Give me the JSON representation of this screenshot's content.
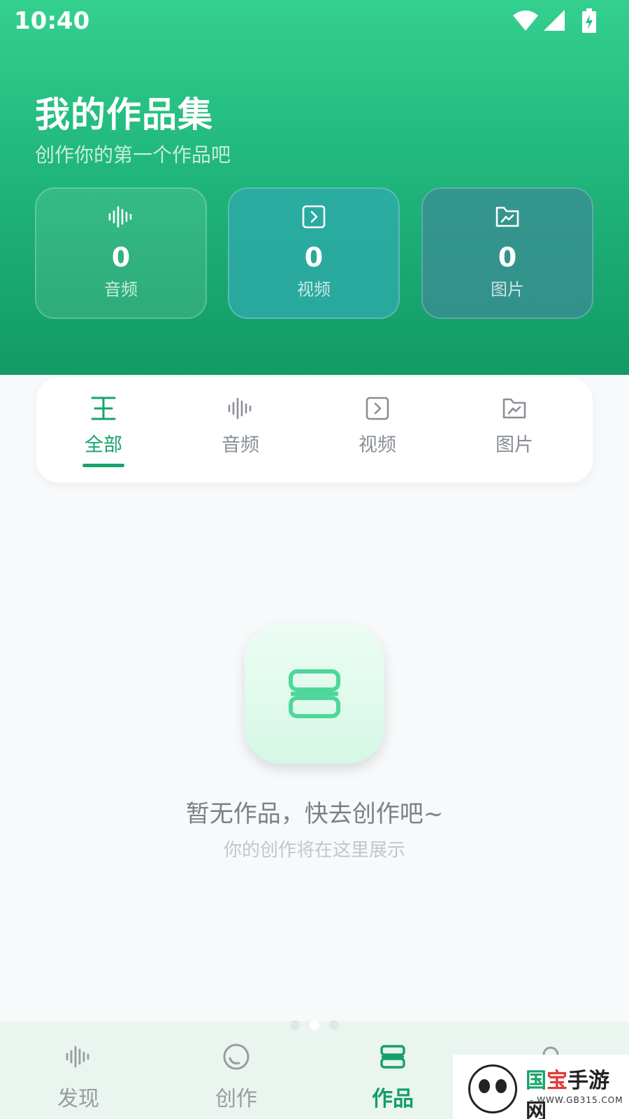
{
  "status_bar": {
    "time": "10:40"
  },
  "header": {
    "title": "我的作品集",
    "subtitle": "创作你的第一个作品吧"
  },
  "stats": [
    {
      "icon": "waveform-icon",
      "value": "0",
      "label": "音频"
    },
    {
      "icon": "play-square-icon",
      "value": "0",
      "label": "视频"
    },
    {
      "icon": "image-folder-icon",
      "value": "0",
      "label": "图片"
    }
  ],
  "filter_tabs": [
    {
      "icon": "all-icon",
      "label": "全部",
      "active": true
    },
    {
      "icon": "waveform-icon",
      "label": "音频",
      "active": false
    },
    {
      "icon": "play-square-icon",
      "label": "视频",
      "active": false
    },
    {
      "icon": "image-folder-icon",
      "label": "图片",
      "active": false
    }
  ],
  "empty_state": {
    "icon": "works-stack-icon",
    "title": "暂无作品，快去创作吧~",
    "subtitle": "你的创作将在这里展示"
  },
  "bottom_nav": [
    {
      "icon": "waveform-icon",
      "label": "发现",
      "active": false
    },
    {
      "icon": "create-circle-icon",
      "label": "创作",
      "active": false
    },
    {
      "icon": "works-stack-icon",
      "label": "作品",
      "active": true
    },
    {
      "icon": "profile-icon",
      "label": "",
      "active": false
    }
  ],
  "watermark": {
    "text_green": "国",
    "text_red": "宝",
    "text_rest": "手游网",
    "url": "- WWW.GB315.COM -"
  },
  "colors": {
    "brand_green": "#18a36b",
    "header_top": "#34d08f",
    "header_bottom": "#139a66"
  }
}
